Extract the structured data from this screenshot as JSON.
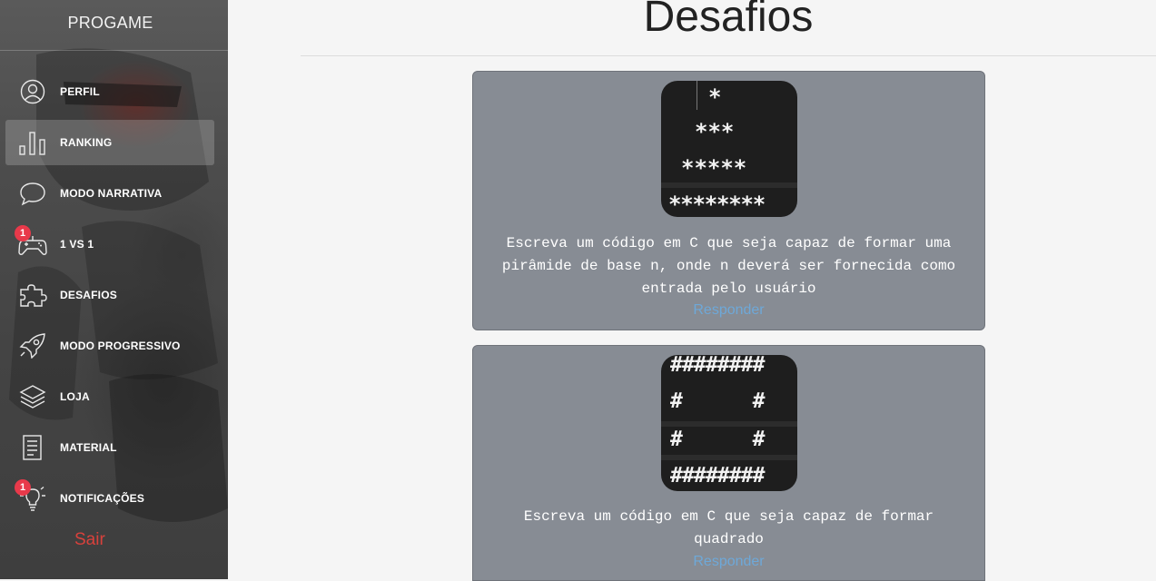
{
  "sidebar": {
    "brand": "PROGAME",
    "items": [
      {
        "label": "PERFIL",
        "icon": "user-icon"
      },
      {
        "label": "RANKING",
        "icon": "bar-chart-icon"
      },
      {
        "label": "MODO NARRATIVA",
        "icon": "chat-bubble-icon"
      },
      {
        "label": "1 VS 1",
        "icon": "gamepad-icon",
        "badge": "1"
      },
      {
        "label": "DESAFIOS",
        "icon": "puzzle-icon"
      },
      {
        "label": "MODO PROGRESSIVO",
        "icon": "rocket-icon"
      },
      {
        "label": "LOJA",
        "icon": "layers-icon"
      },
      {
        "label": "MATERIAL",
        "icon": "document-icon"
      },
      {
        "label": "NOTIFICAÇÕES",
        "icon": "lightbulb-icon",
        "badge": "1"
      }
    ],
    "active_item": "RANKING",
    "logout": "Sair"
  },
  "main": {
    "title": "Desafios",
    "challenges": [
      {
        "art": [
          "*",
          "***",
          "*****",
          "********"
        ],
        "description": "Escreva um código em C que seja capaz de formar uma pirâmide de base n, onde n deverá ser fornecida como entrada pelo usuário",
        "action": "Responder"
      },
      {
        "art": [
          "########",
          "#      #",
          "#      #",
          "########"
        ],
        "description": "Escreva um código em C que seja capaz de formar quadrado",
        "action": "Responder"
      }
    ]
  },
  "colors": {
    "card_bg": "#878c94",
    "link": "#6ea8d8",
    "badge": "#e8394a",
    "logout": "#d8413c"
  }
}
